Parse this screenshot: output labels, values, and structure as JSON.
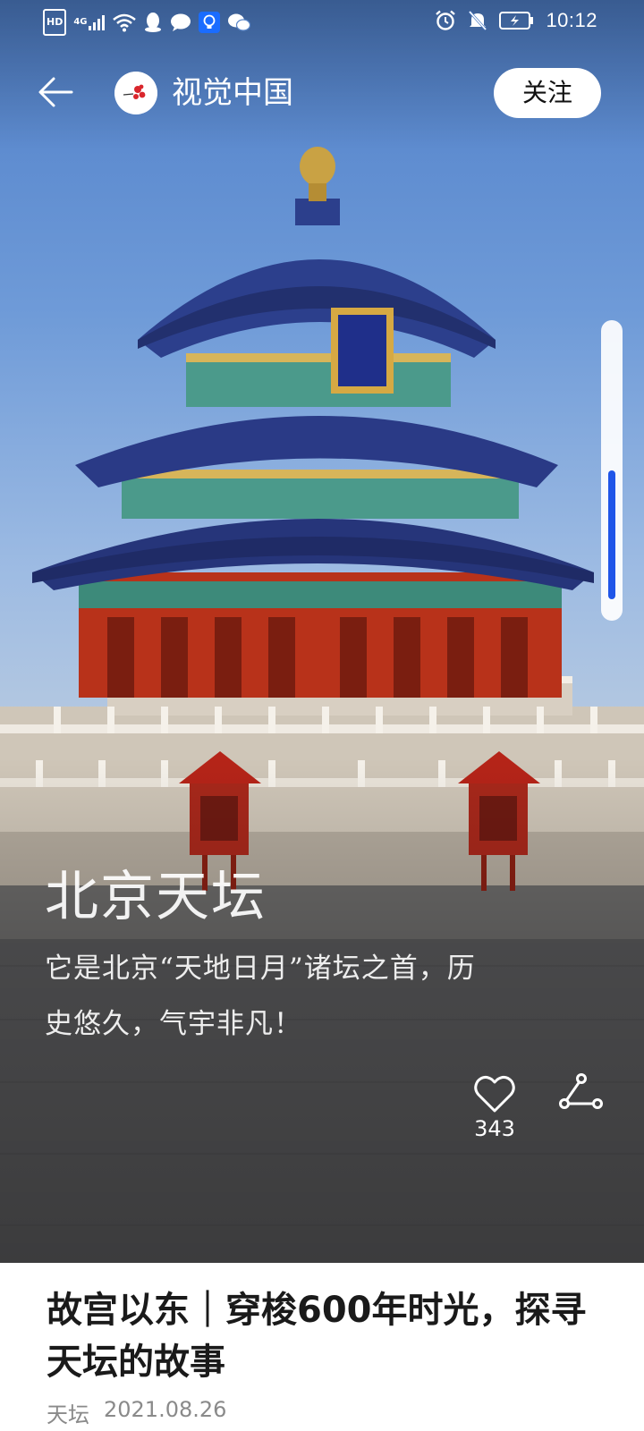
{
  "status_bar": {
    "network_badge": "HD",
    "network_type": "4G",
    "time": "10:12",
    "icons": [
      "hd-icon",
      "signal-icon",
      "wifi-icon",
      "qq-icon",
      "message-icon",
      "bulb-icon",
      "wechat-icon",
      "alarm-icon",
      "mute-icon",
      "battery-charging-icon"
    ]
  },
  "header": {
    "back_icon": "arrow-left-icon",
    "channel_name": "视觉中国",
    "follow_label": "关注"
  },
  "scroll_indicator": {
    "position_start": 0.5,
    "position_end": 0.95
  },
  "hero": {
    "title": "北京天坛",
    "description_line1": "它是北京“天地日月”诸坛之首，历",
    "description_line2": "史悠久，气宇非凡！",
    "like_icon": "heart-icon",
    "like_count": "343",
    "share_icon": "share-icon"
  },
  "article": {
    "title_line1": "故宫以东｜穿梭600年时光，探寻",
    "title_line2": "天坛的故事",
    "tag": "天坛",
    "date": "2021.08.26"
  },
  "colors": {
    "accent": "#1f55e8",
    "follow_bg": "#ffffff",
    "sky_top": "#4f7fc9",
    "roof_blue": "#2c3f8c",
    "pillar_red": "#c1361c"
  }
}
